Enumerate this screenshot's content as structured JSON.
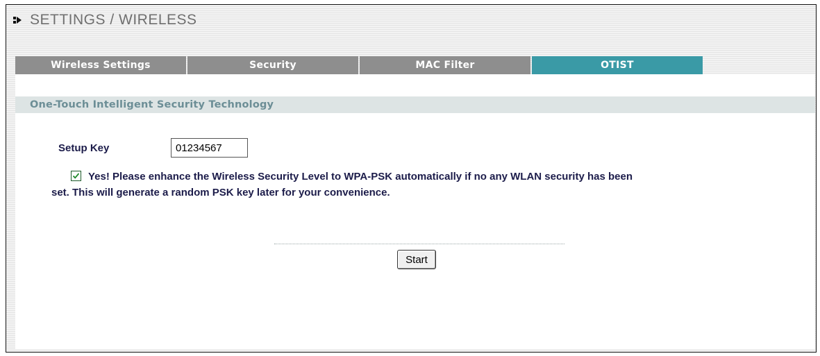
{
  "header": {
    "icon": "arrow-bullet-icon",
    "title": "SETTINGS / WIRELESS"
  },
  "tabs": [
    {
      "label": "Wireless Settings",
      "active": false
    },
    {
      "label": "Security",
      "active": false
    },
    {
      "label": "MAC Filter",
      "active": false
    },
    {
      "label": "OTIST",
      "active": true
    }
  ],
  "colors": {
    "active_tab": "#3a9aa6",
    "inactive_tab": "#8e8e8e",
    "section_header_bg": "#dde4e4",
    "section_title": "#6c8e96"
  },
  "section": {
    "title": "One-Touch Intelligent Security Technology"
  },
  "setup_key": {
    "label": "Setup Key",
    "value": "01234567"
  },
  "enhance_option": {
    "checked": true,
    "line1": "Yes! Please enhance the Wireless Security Level to WPA-PSK automatically if no any WLAN security has been",
    "line2": "set. This will generate a random PSK key later for your convenience."
  },
  "actions": {
    "start_label": "Start"
  }
}
